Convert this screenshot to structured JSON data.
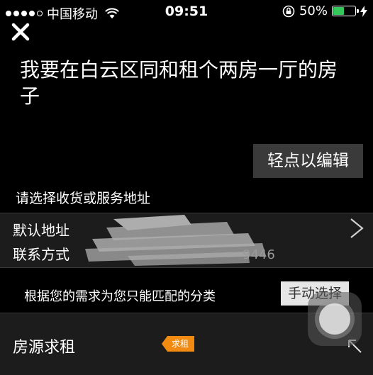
{
  "status_bar": {
    "carrier": "中国移动",
    "time": "09:51",
    "battery_percent": "50%",
    "battery_level": 0.5,
    "icons": [
      "signal-dots",
      "wifi-icon",
      "orientation-lock-icon",
      "battery-icon",
      "charging-bolt-icon"
    ]
  },
  "close_icon": "close-icon",
  "query": {
    "text": "我要在白云区同和租个两房一厅的房子"
  },
  "edit_button": {
    "label": "轻点以编辑"
  },
  "address": {
    "title": "请选择收货或服务地址",
    "default_label": "默认地址",
    "contact_label": "联系方式",
    "contact_partial": "9446",
    "chevron": "chevron-right-icon"
  },
  "match": {
    "text": "根据您的需求为您只能匹配的分类",
    "manual_label": "手动选择"
  },
  "category": {
    "name": "房源求租",
    "tag": "求租",
    "tag_color": "#f08a10",
    "expand_icon": "arrow-up-left-icon"
  },
  "colors": {
    "background": "#000000",
    "accent": "#f08a10",
    "battery": "#34c759"
  }
}
